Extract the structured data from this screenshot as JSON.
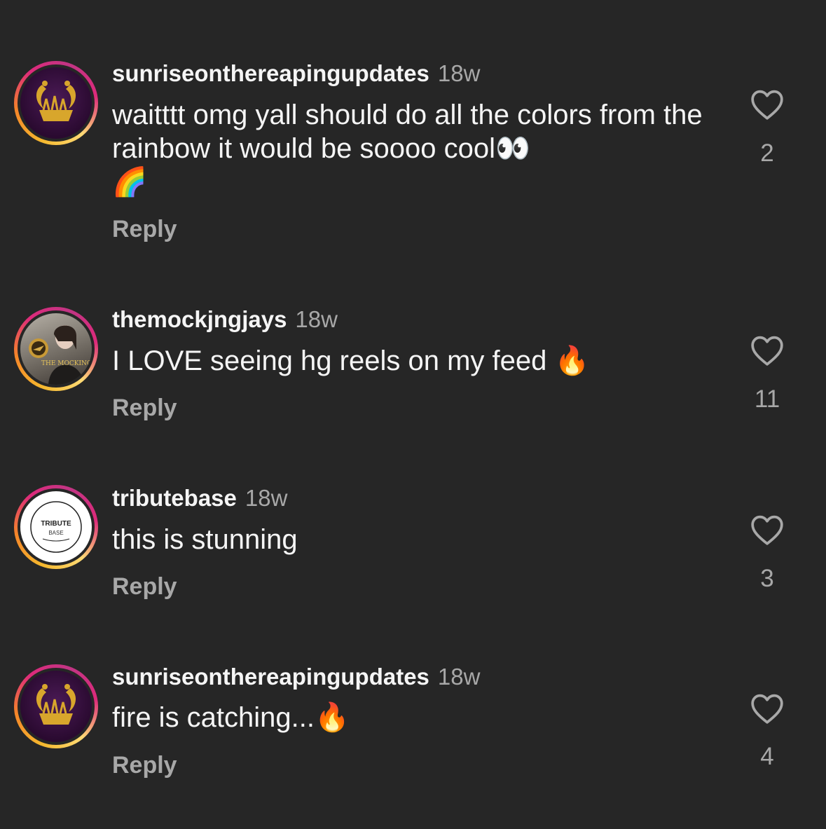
{
  "comments": [
    {
      "username": "sunriseonthereapingupdates",
      "time": "18w",
      "text": "waitttt omg yall should do all the colors from the rainbow it would be soooo cool",
      "emoji_inline": "👀",
      "emoji_next_line": "🌈",
      "reply_label": "Reply",
      "likes": "2",
      "avatar_icon": "phoenix-crest"
    },
    {
      "username": "themockjngjays",
      "time": "18w",
      "text": "I LOVE seeing hg reels on my feed ",
      "emoji_inline": "🔥",
      "reply_label": "Reply",
      "likes": "11",
      "avatar_icon": "mockingjay-pin-photo",
      "avatar_text": "THE MOCKINGJAYS"
    },
    {
      "username": "tributebase",
      "time": "18w",
      "text": "this is stunning",
      "reply_label": "Reply",
      "likes": "3",
      "avatar_icon": "tribute-base-logo",
      "avatar_text_top": "TRIBUTE",
      "avatar_text_bottom": "BASE"
    },
    {
      "username": "sunriseonthereapingupdates",
      "time": "18w",
      "text": "fire is catching...",
      "emoji_inline": "🔥",
      "reply_label": "Reply",
      "likes": "4",
      "avatar_icon": "phoenix-crest"
    }
  ],
  "colors": {
    "background": "#262626",
    "primary_text": "#f5f5f5",
    "secondary_text": "#a8a8a8",
    "story_ring": [
      "#f58529",
      "#dd2a7b",
      "#feda75"
    ]
  }
}
